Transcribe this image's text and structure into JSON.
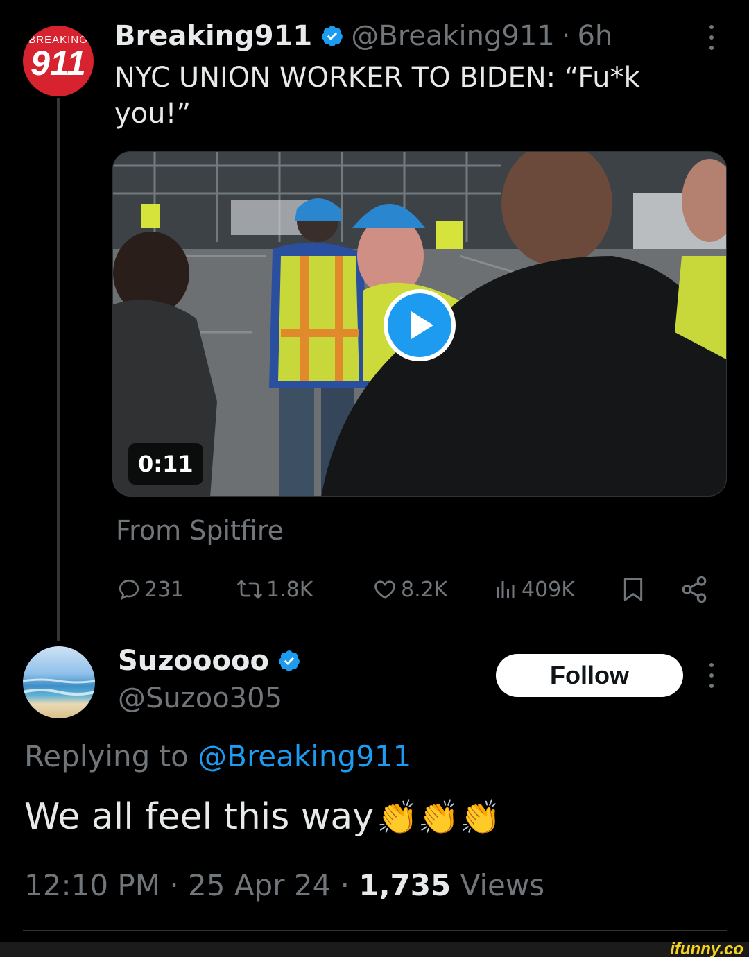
{
  "tweet": {
    "avatar_top": "BREAKING",
    "avatar_num": "911",
    "display_name": "Breaking911",
    "handle": "@Breaking911",
    "separator": "·",
    "time": "6h",
    "text": "NYC UNION WORKER TO BIDEN: “Fu*k you!”",
    "media": {
      "type": "video",
      "duration": "0:11",
      "icon": "play-icon"
    },
    "from": "From Spitfire",
    "stats": {
      "replies": "231",
      "reposts": "1.8K",
      "likes": "8.2K",
      "views": "409K"
    }
  },
  "reply": {
    "display_name": "Suzooooo",
    "handle": "@Suzoo305",
    "follow_label": "Follow",
    "replying_prefix": "Replying to ",
    "replying_mention": "@Breaking911",
    "text": "We all feel this way",
    "emoji": "👏👏👏",
    "time": "12:10 PM",
    "date": "25 Apr 24",
    "views_count": "1,735",
    "views_label": "Views",
    "separator": "·"
  },
  "watermark": "ifunny.co",
  "colors": {
    "accent": "#1d9bf0",
    "background": "#000000",
    "muted": "#71767b",
    "text": "#e7e9ea",
    "avatar_red": "#d7232f"
  }
}
